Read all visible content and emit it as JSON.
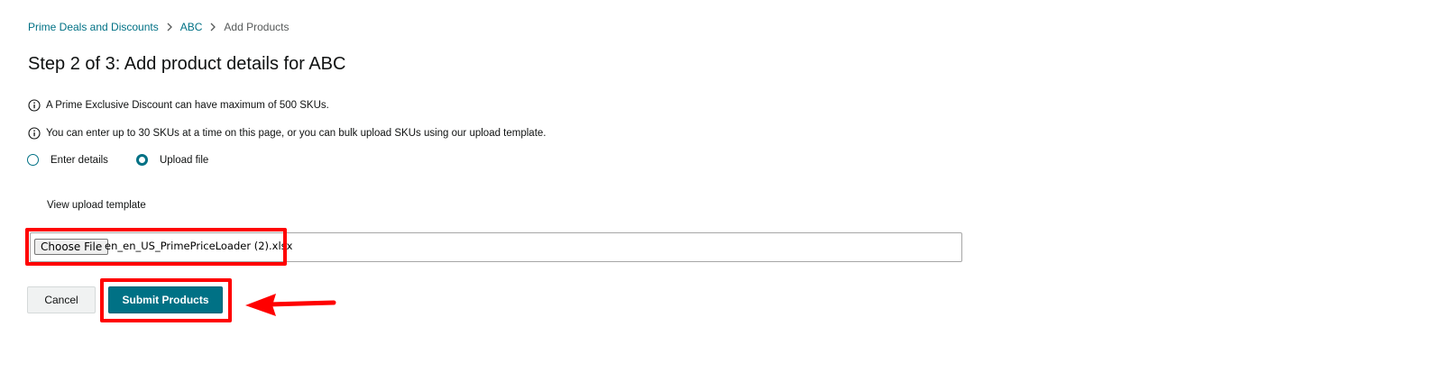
{
  "breadcrumb": {
    "items": [
      {
        "label": "Prime Deals and Discounts"
      },
      {
        "label": "ABC"
      },
      {
        "label": "Add Products"
      }
    ]
  },
  "page_title": "Step 2 of 3: Add product details for ABC",
  "info": [
    {
      "icon": "info-icon",
      "text": "A Prime Exclusive Discount can have maximum of 500 SKUs."
    },
    {
      "icon": "info-icon",
      "text": "You can enter up to 30 SKUs at a time on this page, or you can bulk upload SKUs using our upload template."
    }
  ],
  "entry_mode": {
    "options": [
      {
        "label": "Enter details",
        "selected": false
      },
      {
        "label": "Upload file",
        "selected": true
      }
    ]
  },
  "template_link": "View upload template",
  "file_upload": {
    "button_label": "Choose File",
    "file_name": "en_en_US_PrimePriceLoader (2).xlsx"
  },
  "actions": {
    "cancel_label": "Cancel",
    "submit_label": "Submit Products"
  },
  "colors": {
    "accent": "#007185",
    "annotation": "#ff0000"
  }
}
